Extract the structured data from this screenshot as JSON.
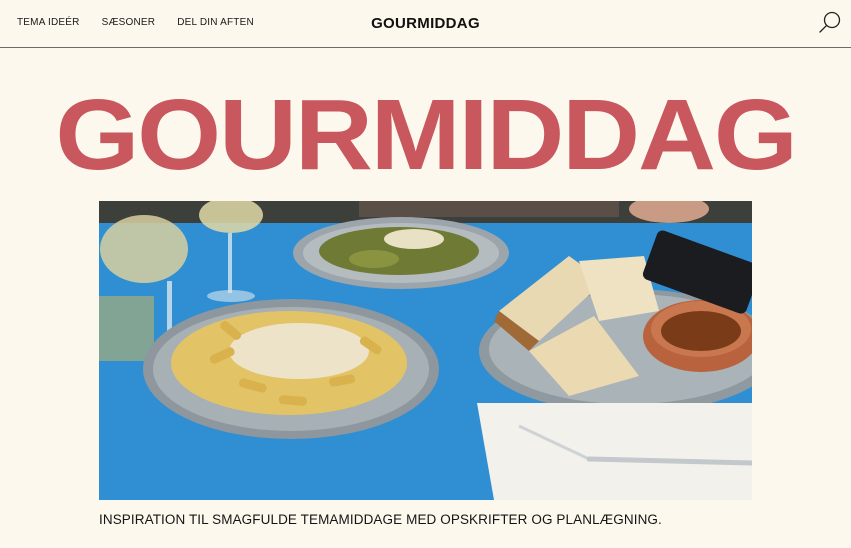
{
  "header": {
    "nav": [
      {
        "label": "TEMA IDEÉR"
      },
      {
        "label": "SÆSONER"
      },
      {
        "label": "DEL DIN AFTEN"
      }
    ],
    "brand": "GOURMIDDAG",
    "search_icon": "search-icon"
  },
  "hero": {
    "title": "GOURMIDDAG",
    "title_color": "#c8575e",
    "caption": "INSPIRATION TIL SMAGFULDE TEMAMIDDAGE MED OPSKRIFTER OG PLANLÆGNING."
  },
  "colors": {
    "background": "#fdf8ed",
    "table_blue": "#2f8fd2",
    "text": "#141414"
  }
}
